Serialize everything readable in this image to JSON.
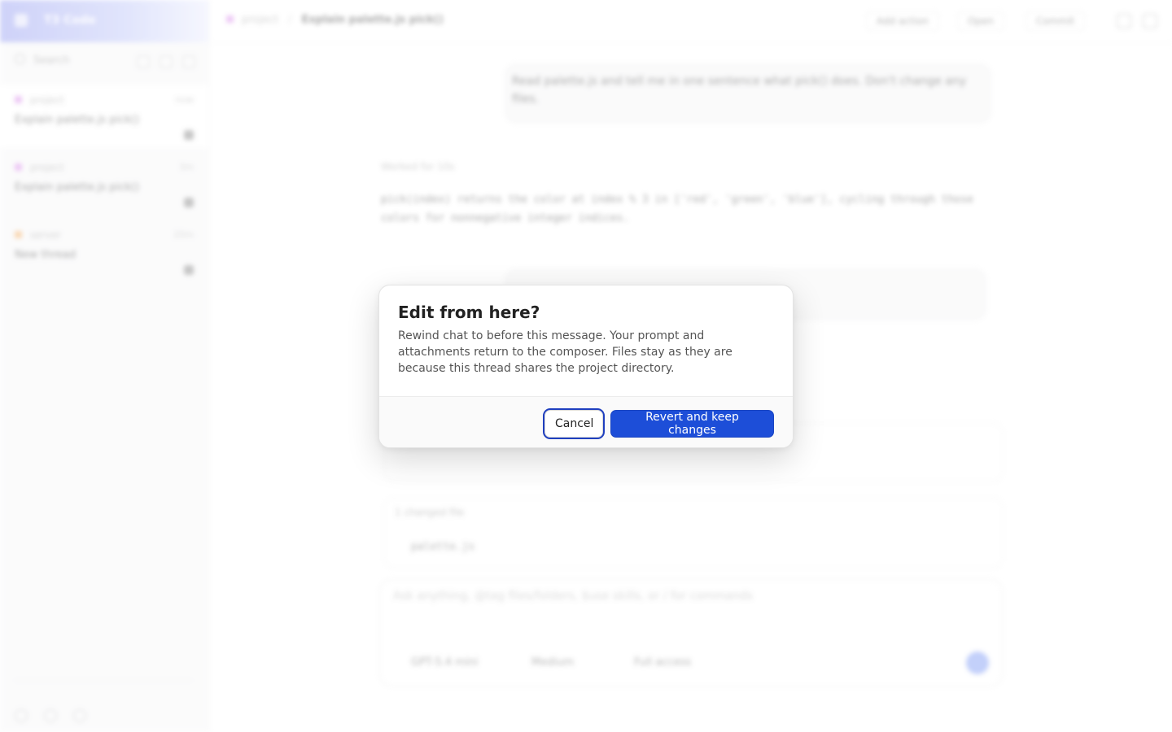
{
  "dialog": {
    "title": "Edit from here?",
    "message": "Rewind chat to before this message. Your prompt and attachments return to the composer. Files stay as they are because this thread shares the project directory.",
    "cancel_label": "Cancel",
    "confirm_label": "Revert and keep changes"
  },
  "background": {
    "app_name": "T3 Code",
    "search_label": "Search",
    "threads": [
      {
        "project": "project",
        "time": "now",
        "title": "Explain palette.js pick()",
        "color": "#d57ae8",
        "active": true
      },
      {
        "project": "project",
        "time": "3m",
        "title": "Explain palette.js pick()",
        "color": "#d57ae8",
        "active": false
      },
      {
        "project": "server",
        "time": "20m",
        "title": "New thread",
        "color": "#f0a04b",
        "active": false
      }
    ],
    "breadcrumb_project": "project",
    "breadcrumb_thread": "Explain palette.js pick()",
    "top_actions": [
      "Add action",
      "Open",
      "Commit"
    ],
    "user_message_1": "Read palette.js and tell me in one sentence what pick() does. Don't change any files.",
    "worked_for": "Worked for 10s",
    "assistant_reply": "pick(index) returns the color at index % 3 in ['red', 'green', 'blue'], cycling through those colors for nonnegative integer indices.",
    "changed_files_label": "1 changed file",
    "changed_file": "palette.js",
    "composer_placeholder": "Ask anything, @tag files/folders, $use skills, or / for commands",
    "model_label": "GPT-5.4 mini",
    "effort_label": "Medium",
    "access_label": "Full access"
  }
}
